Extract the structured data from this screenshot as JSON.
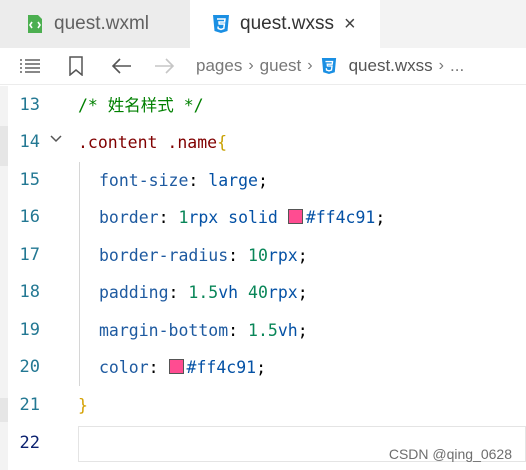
{
  "tabs": [
    {
      "label": "quest.wxml",
      "icon": "wxml-file-icon",
      "active": false
    },
    {
      "label": "quest.wxss",
      "icon": "css-file-icon",
      "active": true,
      "close": "×"
    }
  ],
  "breadcrumb": {
    "items": [
      "pages",
      "guest",
      "quest.wxss"
    ],
    "more": "..."
  },
  "colors": {
    "swatch": "#ff4c91",
    "css_icon": "#1a8fe3",
    "wxml_icon": "#4caf50"
  },
  "lines": [
    {
      "num": "13",
      "text": "/* 姓名样式 */"
    },
    {
      "num": "14",
      "selector": ".content .name",
      "brace": "{"
    },
    {
      "num": "15",
      "prop": "font-size",
      "value": "large"
    },
    {
      "num": "16",
      "prop": "border",
      "value_num": "1",
      "value_unit": "rpx",
      "value_kw": "solid",
      "value_color": "#ff4c91"
    },
    {
      "num": "17",
      "prop": "border-radius",
      "value_num": "10",
      "value_unit": "rpx"
    },
    {
      "num": "18",
      "prop": "padding",
      "value_num": "1.5",
      "value_unit": "vh",
      "value_num2": "40",
      "value_unit2": "rpx"
    },
    {
      "num": "19",
      "prop": "margin-bottom",
      "value_num": "1.5",
      "value_unit": "vh"
    },
    {
      "num": "20",
      "prop": "color",
      "value_color": "#ff4c91"
    },
    {
      "num": "21",
      "brace": "}"
    },
    {
      "num": "22"
    }
  ],
  "watermark": "CSDN @qing_0628"
}
